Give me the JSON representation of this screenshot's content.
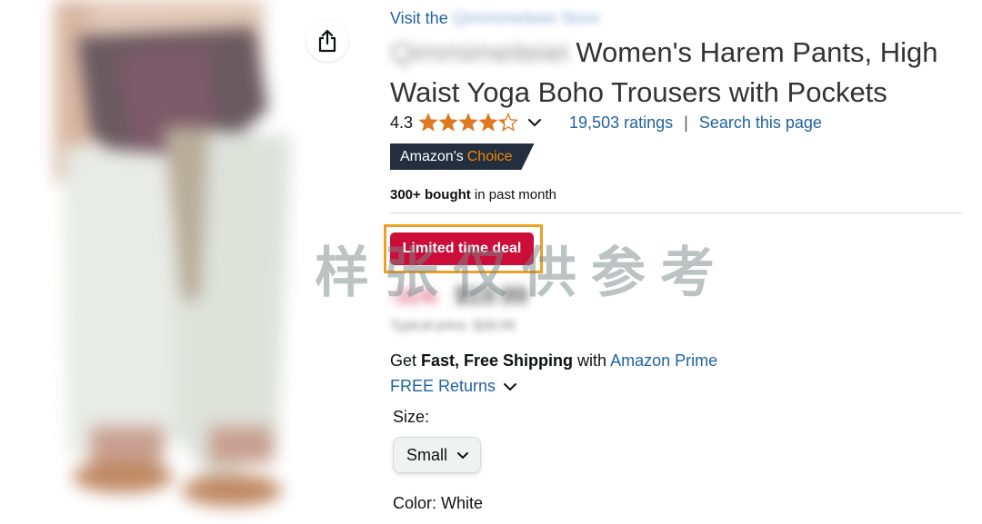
{
  "gallery": {
    "image_alt": "product-photo",
    "share_icon": "share-icon"
  },
  "store": {
    "visit_prefix": "Visit the",
    "store_name_blurred": "Qimmimeiteiei Store"
  },
  "product": {
    "brand_blurred": "Qimmimeiteiei",
    "title": "Women's Harem Pants, High Waist Yoga Boho Trousers with Pockets",
    "rating": "4.3",
    "rating_stars": 4.3,
    "star_color": "#de7921",
    "ratings_count": "19,503 ratings",
    "separator": "|",
    "search_link": "Search this page"
  },
  "badge": {
    "choice_prefix": "Amazon's",
    "choice_accent": "Choice",
    "choice_bg": "#232f3e",
    "choice_accent_color": "#f08804"
  },
  "social_proof": {
    "bought_bold": "300+ bought",
    "bought_rest": " in past month"
  },
  "deal": {
    "label": "Limited time deal",
    "color": "#cc0c39",
    "highlight_color": "#f0a020"
  },
  "price": {
    "discount_blurred": "-31%",
    "amount_blurred": "$19.99",
    "list_price_blurred": "Typical price: $28.99"
  },
  "shipping": {
    "prefix": "Get ",
    "bold": "Fast, Free Shipping",
    "middle": " with ",
    "prime_link": "Amazon Prime",
    "returns": "FREE Returns"
  },
  "size": {
    "label": "Size:",
    "selected": "Small"
  },
  "color": {
    "label": "Color: ",
    "value": "White"
  },
  "watermark": {
    "text": "样张仅供参考"
  },
  "colors": {
    "link": "#2162a1",
    "title_text": "#333333",
    "divider": "#d5d9d9"
  }
}
